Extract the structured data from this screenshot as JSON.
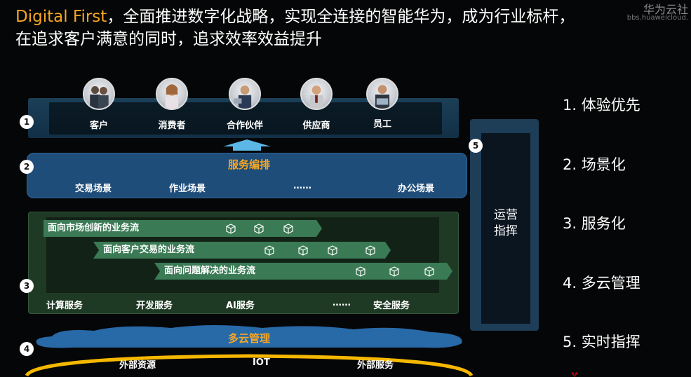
{
  "title": {
    "highlight": "Digital First",
    "line1_rest": "，全面推进数字化战略，实现全连接的智能华为，成为行业标杆，",
    "line2": "在追求客户满意的同时，追求效率效益提升"
  },
  "watermark": {
    "brand": "华为云社",
    "url": "bbs.huaweicloud."
  },
  "badges": [
    "1",
    "2",
    "3",
    "4",
    "5"
  ],
  "layer1": {
    "roles": [
      "客户",
      "消费者",
      "合作伙伴",
      "供应商",
      "员工"
    ]
  },
  "layer2": {
    "title": "服务编排",
    "items": [
      "交易场景",
      "作业场景",
      "……",
      "办公场景"
    ]
  },
  "layer3": {
    "flows": [
      "面向市场创新的业务流",
      "面向客户交易的业务流",
      "面向问题解决的业务流"
    ],
    "services": [
      "计算服务",
      "开发服务",
      "AI服务",
      "……",
      "安全服务"
    ]
  },
  "layer4": {
    "title": "多云管理",
    "items": [
      "外部资源",
      "IOT",
      "外部服务"
    ]
  },
  "layer5": {
    "line1": "运营",
    "line2": "指挥"
  },
  "principles": [
    "1. 体验优先",
    "2. 场景化",
    "3. 服务化",
    "4. 多云管理",
    "5. 实时指挥"
  ],
  "colors": {
    "accent": "#f5a623",
    "layer1": "#1b3f57",
    "layer2": "#1f4d7a",
    "layer3": "#1f3a24",
    "flow": "#3a7a54",
    "layer5": "#1e3d57"
  }
}
